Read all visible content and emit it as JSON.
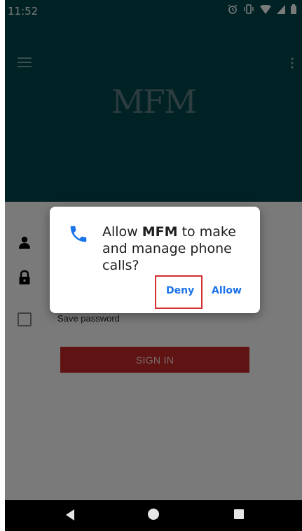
{
  "status_bar": {
    "time": "11:52",
    "icons": [
      "alarm-icon",
      "vibrate-icon",
      "wifi-icon",
      "signal-icon",
      "battery-icon"
    ]
  },
  "header": {
    "logo_text": "MFM",
    "icons": [
      "menu-icon",
      "overflow-menu-icon"
    ]
  },
  "form": {
    "save_password_label": "Save password",
    "sign_in_label": "SIGN IN",
    "save_password_checked": false
  },
  "dialog": {
    "message_prefix": "Allow ",
    "app_name": "MFM",
    "message_suffix": " to make and manage phone calls?",
    "deny_label": "Deny",
    "allow_label": "Allow"
  },
  "colors": {
    "header_bg": "#00484d",
    "accent_blue": "#1a73e8",
    "sign_in_bg": "#c62828",
    "highlight_red": "#d32f2f"
  }
}
